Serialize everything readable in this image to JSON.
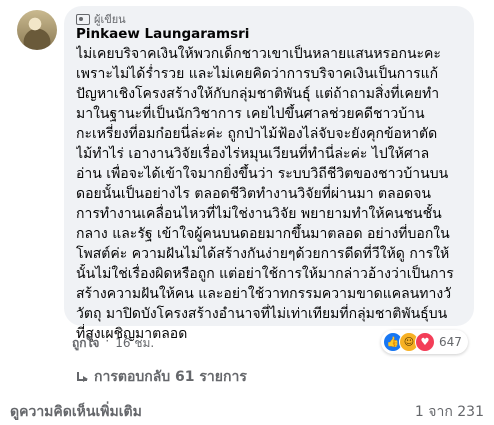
{
  "comment": {
    "author_badge": "ผู้เขียน",
    "author_name": "Pinkaew Laungaramsri",
    "lines": [
      "ไม่เคยบริจาคเงินให้พวกเด็กชาวเขาเป็นหลายแสนหรอกนะคะ",
      "เพราะไม่ได้ร่ำรวย และไม่เคยคิดว่าการบริจาคเงินเป็นการแก้",
      "ปัญหาเชิงโครงสร้างให้กับกลุ่มชาติพันธุ์ แต่ถ้าถามสิ่งที่เคยทำ",
      "มาในฐานะที่เป็นนักวิชาการ เคยไปขึ้นศาลช่วยคดีชาวบ้าน",
      "กะเหรี่ยงที่อมก๋อยนี่ล่ะค่ะ ถูกป่าไม้ฟ้องไล่จับจะยังคุกข้อหาตัด",
      "ไม้ทำไร่ เอางานวิจัยเรื่องไร่หมุนเวียนที่ทำนี่ล่ะค่ะ ไปให้ศาล",
      "อ่าน เพื่อจะได้เข้าใจมากยิ่งขึ้นว่า ระบบวิถีชีวิตของชาวบ้านบน",
      "ดอยนั้นเป็นอย่างไร ตลอดชีวิตทำงานวิจัยที่ผ่านมา ตลอดจน",
      "การทำงานเคลื่อนไหวที่ไม่ใช่งานวิจัย พยายามทำให้คนชนชั้น",
      "กลาง และรัฐ เข้าใจผู้คนบนดอยมากขึ้นมาตลอด อย่างที่บอกใน",
      "โพสต์ค่ะ ความฝันไม่ได้สร้างกันง่ายๆด้วยการดีดที่วีให้ดู การให้",
      "นั้นไม่ใช่เรื่องผิดหรือถูก แต่อย่าใช้การให้มากล่าวอ้างว่าเป็นการ",
      "สร้างความฝันให้คน และอย่าใช้วาทกรรมความขาดแคลนทางวั",
      "วัตถุ มาปิดบังโครงสร้างอำนาจที่ไม่เท่าเทียมที่กลุ่มชาติพันธุ์บน",
      "ที่สูงเผชิญมาตลอด"
    ],
    "like_label": "ถูกใจ",
    "separator": "·",
    "time_ago": "16 ชม.",
    "reaction_count": "647",
    "reaction_icons": [
      "like-icon",
      "haha-icon",
      "love-icon"
    ],
    "replies_label": "การตอบกลับ 61 รายการ"
  },
  "footer": {
    "more_comments": "ดูความคิดเห็นเพิ่มเติม",
    "pager": "1 จาก 231"
  },
  "colors": {
    "bubble": "#f0f2f5",
    "secondary_text": "#65676b",
    "like_blue": "#1877f2",
    "love_red": "#f33e58",
    "haha_yellow": "#f7b125"
  }
}
